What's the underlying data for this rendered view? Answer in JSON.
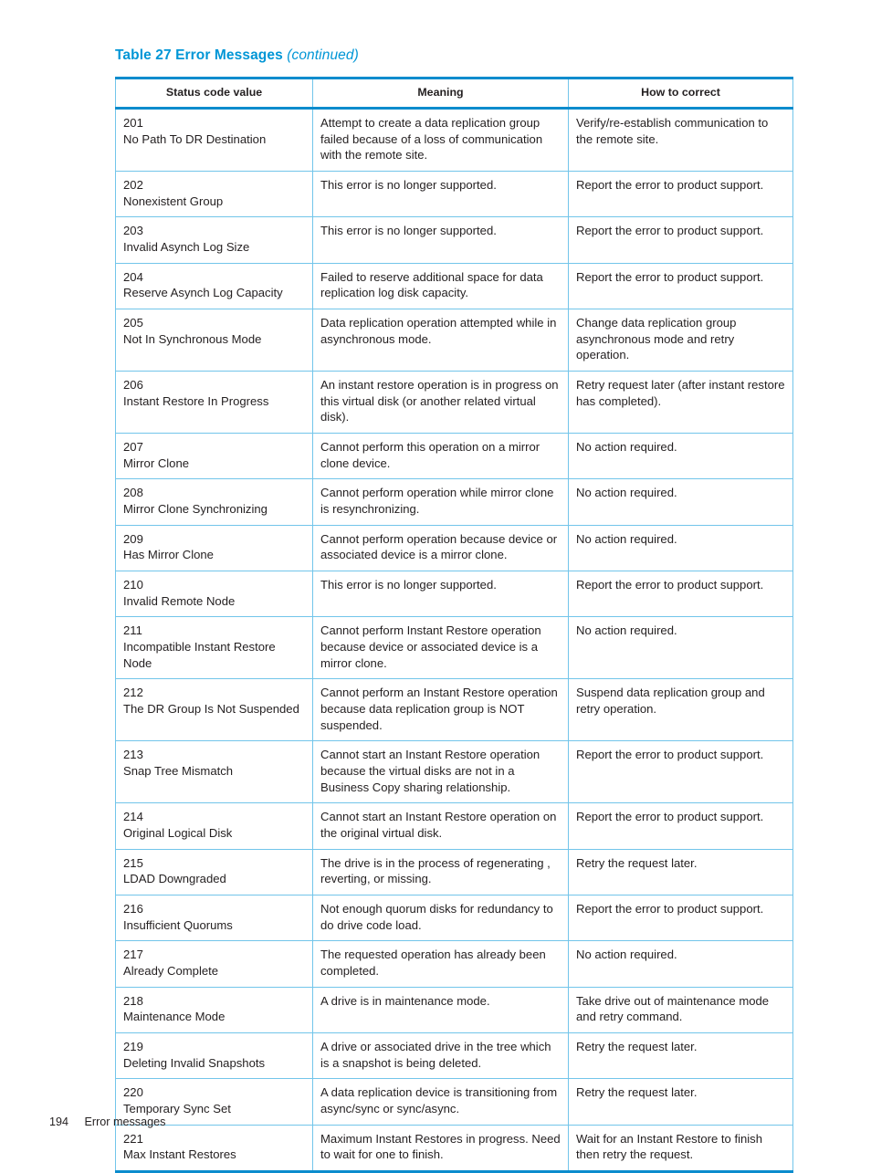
{
  "caption": {
    "label": "Table 27 Error Messages",
    "continued": "(continued)",
    "accent_color": "#0096D6"
  },
  "table": {
    "border_color": "#0B8CCD",
    "inner_border_color": "#72C5EA",
    "headers": {
      "col1": "Status code value",
      "col2": "Meaning",
      "col3": "How to correct"
    },
    "rows": [
      {
        "code": "201",
        "name": "No Path To DR Destination",
        "meaning": "Attempt to create a data replication group failed because of a loss of communication with the remote site.",
        "correct": "Verify/re-establish communication to the remote site."
      },
      {
        "code": "202",
        "name": "Nonexistent Group",
        "meaning": "This error is no longer supported.",
        "correct": "Report the error to product support."
      },
      {
        "code": "203",
        "name": "Invalid Asynch Log Size",
        "meaning": "This error is no longer supported.",
        "correct": "Report the error to product support."
      },
      {
        "code": "204",
        "name": "Reserve Asynch Log Capacity",
        "meaning": "Failed to reserve additional space for data replication log disk capacity.",
        "correct": "Report the error to product support."
      },
      {
        "code": "205",
        "name": "Not In Synchronous Mode",
        "meaning": "Data replication operation attempted while in asynchronous mode.",
        "correct": "Change data replication group asynchronous mode and retry operation."
      },
      {
        "code": "206",
        "name": "Instant Restore In Progress",
        "meaning": "An instant restore operation is in progress on this virtual disk (or another related virtual disk).",
        "correct": "Retry request later (after instant restore has completed)."
      },
      {
        "code": "207",
        "name": "Mirror Clone",
        "meaning": "Cannot perform this operation on a mirror clone device.",
        "correct": "No action required."
      },
      {
        "code": "208",
        "name": "Mirror Clone Synchronizing",
        "meaning": "Cannot perform operation while mirror clone is resynchronizing.",
        "correct": "No action required."
      },
      {
        "code": "209",
        "name": "Has Mirror Clone",
        "meaning": "Cannot perform operation because device or associated device is a mirror clone.",
        "correct": "No action required."
      },
      {
        "code": "210",
        "name": "Invalid Remote Node",
        "meaning": "This error is no longer supported.",
        "correct": "Report the error to product support."
      },
      {
        "code": "211",
        "name": "Incompatible Instant Restore Node",
        "meaning": "Cannot perform Instant Restore operation because device or associated device is a mirror clone.",
        "correct": "No action required."
      },
      {
        "code": "212",
        "name": "The DR Group Is Not Suspended",
        "meaning": "Cannot perform an Instant Restore operation because data replication group is NOT suspended.",
        "correct": "Suspend data replication group and retry operation."
      },
      {
        "code": "213",
        "name": "Snap Tree Mismatch",
        "meaning": "Cannot start an Instant Restore operation because the virtual disks are not in a Business Copy sharing relationship.",
        "correct": "Report the error to product support."
      },
      {
        "code": "214",
        "name": "Original Logical Disk",
        "meaning": "Cannot start an Instant Restore operation on the original virtual disk.",
        "correct": "Report the error to product support."
      },
      {
        "code": "215",
        "name": "LDAD Downgraded",
        "meaning": "The drive is in the process of regenerating , reverting, or missing.",
        "correct": "Retry the request later."
      },
      {
        "code": "216",
        "name": "Insufficient Quorums",
        "meaning": "Not enough quorum disks for redundancy to do drive code load.",
        "correct": "Report the error to product support."
      },
      {
        "code": "217",
        "name": "Already Complete",
        "meaning": "The requested operation has already been completed.",
        "correct": "No action required."
      },
      {
        "code": "218",
        "name": "Maintenance Mode",
        "meaning": "A drive is in maintenance mode.",
        "correct": "Take drive out of maintenance mode and retry command."
      },
      {
        "code": "219",
        "name": "Deleting Invalid Snapshots",
        "meaning": "A drive or associated drive in the tree which is a snapshot is being deleted.",
        "correct": "Retry the request later."
      },
      {
        "code": "220",
        "name": "Temporary Sync Set",
        "meaning": "A data replication device is transitioning from async/sync or sync/async.",
        "correct": "Retry the request later."
      },
      {
        "code": "221",
        "name": "Max Instant Restores",
        "meaning": "Maximum Instant Restores in progress. Need to wait for one to finish.",
        "correct": "Wait for an Instant Restore to finish then retry the request."
      }
    ]
  },
  "footer": {
    "page_number": "194",
    "section": "Error messages"
  }
}
